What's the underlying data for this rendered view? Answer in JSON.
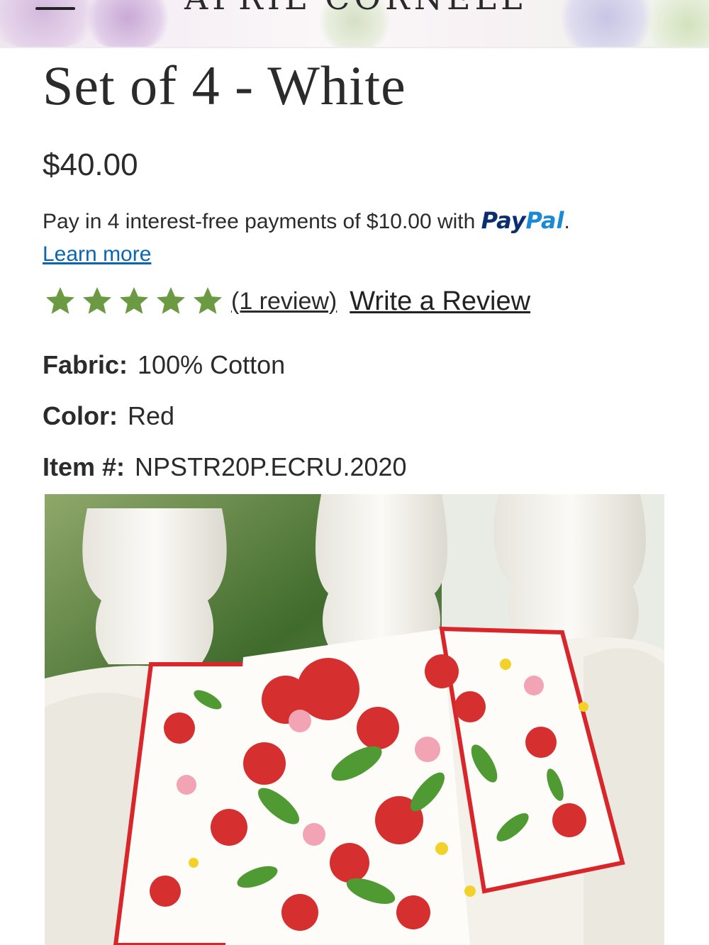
{
  "header": {
    "logo_text": "APRIL CORNELL",
    "menu_icon": "hamburger-menu-icon",
    "logo_icon": "flower-logo-icon"
  },
  "product": {
    "title": "Set of 4 - White",
    "price": "$40.00",
    "paypal": {
      "message": "Pay in 4 interest-free payments of $10.00 with ",
      "logo_part1": "Pay",
      "logo_part2": "Pal",
      "suffix": ".",
      "learn_more": "Learn more"
    },
    "rating": {
      "stars": 5,
      "max": 5,
      "review_link": "(1 review)",
      "write_review": "Write a Review",
      "star_color": "#6b9a43"
    },
    "specs": [
      {
        "label": "Fabric:",
        "value": "100% Cotton"
      },
      {
        "label": "Color:",
        "value": "Red"
      },
      {
        "label": "Item #:",
        "value": "NPSTR20P.ECRU.2020"
      }
    ]
  },
  "colors": {
    "paypal_dark": "#0b2e6f",
    "paypal_light": "#1a8ad4",
    "link": "#0b66b2",
    "text": "#2b2b2b"
  }
}
